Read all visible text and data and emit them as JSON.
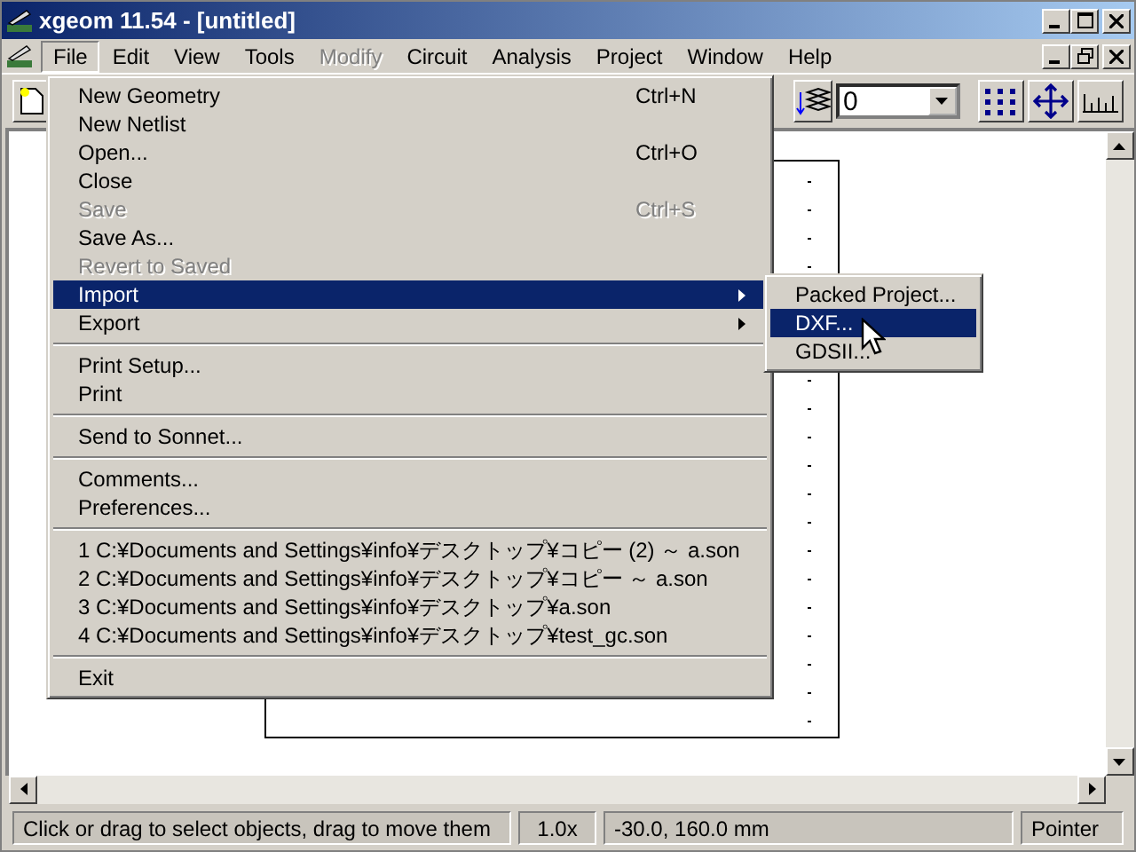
{
  "window": {
    "title": "xgeom 11.54 - [untitled]"
  },
  "menubar": [
    {
      "label": "File",
      "selected": true,
      "disabled": false
    },
    {
      "label": "Edit",
      "selected": false,
      "disabled": false
    },
    {
      "label": "View",
      "selected": false,
      "disabled": false
    },
    {
      "label": "Tools",
      "selected": false,
      "disabled": false
    },
    {
      "label": "Modify",
      "selected": false,
      "disabled": true
    },
    {
      "label": "Circuit",
      "selected": false,
      "disabled": false
    },
    {
      "label": "Analysis",
      "selected": false,
      "disabled": false
    },
    {
      "label": "Project",
      "selected": false,
      "disabled": false
    },
    {
      "label": "Window",
      "selected": false,
      "disabled": false
    },
    {
      "label": "Help",
      "selected": false,
      "disabled": false
    }
  ],
  "toolbar": {
    "level_combo": {
      "value": "0"
    }
  },
  "file_menu": [
    {
      "kind": "item",
      "label": "New Geometry",
      "shortcut": "Ctrl+N",
      "disabled": false,
      "selected": false,
      "submenu": false
    },
    {
      "kind": "item",
      "label": "New Netlist",
      "disabled": false,
      "selected": false,
      "submenu": false
    },
    {
      "kind": "item",
      "label": "Open...",
      "shortcut": "Ctrl+O",
      "disabled": false,
      "selected": false,
      "submenu": false
    },
    {
      "kind": "item",
      "label": "Close",
      "disabled": false,
      "selected": false,
      "submenu": false
    },
    {
      "kind": "item",
      "label": "Save",
      "shortcut": "Ctrl+S",
      "disabled": true,
      "selected": false,
      "submenu": false
    },
    {
      "kind": "item",
      "label": "Save As...",
      "disabled": false,
      "selected": false,
      "submenu": false
    },
    {
      "kind": "item",
      "label": "Revert to Saved",
      "disabled": true,
      "selected": false,
      "submenu": false
    },
    {
      "kind": "item",
      "label": "Import",
      "disabled": false,
      "selected": true,
      "submenu": true
    },
    {
      "kind": "item",
      "label": "Export",
      "disabled": false,
      "selected": false,
      "submenu": true
    },
    {
      "kind": "separator"
    },
    {
      "kind": "item",
      "label": "Print Setup...",
      "disabled": false,
      "selected": false,
      "submenu": false
    },
    {
      "kind": "item",
      "label": "Print",
      "disabled": false,
      "selected": false,
      "submenu": false
    },
    {
      "kind": "separator"
    },
    {
      "kind": "item",
      "label": "Send to Sonnet...",
      "disabled": false,
      "selected": false,
      "submenu": false
    },
    {
      "kind": "separator"
    },
    {
      "kind": "item",
      "label": "Comments...",
      "disabled": false,
      "selected": false,
      "submenu": false
    },
    {
      "kind": "item",
      "label": "Preferences...",
      "disabled": false,
      "selected": false,
      "submenu": false
    },
    {
      "kind": "separator"
    },
    {
      "kind": "item",
      "label": "1 C:¥Documents and Settings¥info¥デスクトップ¥コピー (2) ～ a.son",
      "disabled": false,
      "selected": false,
      "submenu": false
    },
    {
      "kind": "item",
      "label": "2 C:¥Documents and Settings¥info¥デスクトップ¥コピー ～ a.son",
      "disabled": false,
      "selected": false,
      "submenu": false
    },
    {
      "kind": "item",
      "label": "3 C:¥Documents and Settings¥info¥デスクトップ¥a.son",
      "disabled": false,
      "selected": false,
      "submenu": false
    },
    {
      "kind": "item",
      "label": "4 C:¥Documents and Settings¥info¥デスクトップ¥test_gc.son",
      "disabled": false,
      "selected": false,
      "submenu": false
    },
    {
      "kind": "separator"
    },
    {
      "kind": "item",
      "label": "Exit",
      "disabled": false,
      "selected": false,
      "submenu": false
    }
  ],
  "import_submenu": [
    {
      "label": "Packed Project...",
      "selected": false
    },
    {
      "label": "DXF...",
      "selected": true
    },
    {
      "label": "GDSII...",
      "selected": false
    }
  ],
  "status_bar": [
    "Click or drag to select objects, drag to move them",
    "1.0x",
    "-30.0, 160.0 mm",
    "Pointer"
  ]
}
